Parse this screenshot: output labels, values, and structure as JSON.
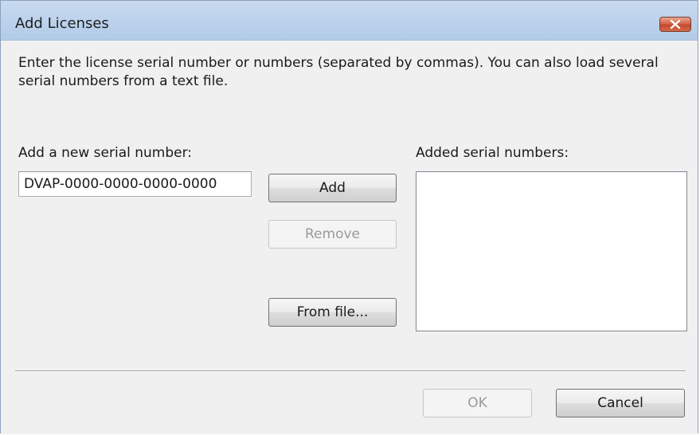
{
  "window": {
    "title": "Add Licenses",
    "close_icon": "close-x-icon"
  },
  "instructions": "Enter the license serial number or numbers (separated by commas). You can also load several serial numbers from a text file.",
  "new_serial": {
    "label": "Add a new serial number:",
    "value": "DVAP-0000-0000-0000-0000"
  },
  "buttons": {
    "add": "Add",
    "remove": "Remove",
    "from_file": "From file...",
    "ok": "OK",
    "cancel": "Cancel"
  },
  "added_serials": {
    "label": "Added serial numbers:",
    "items": []
  },
  "colors": {
    "titlebar": "#bed3ec",
    "close_button": "#c24a2c",
    "dialog_background": "#f0f0f0"
  }
}
